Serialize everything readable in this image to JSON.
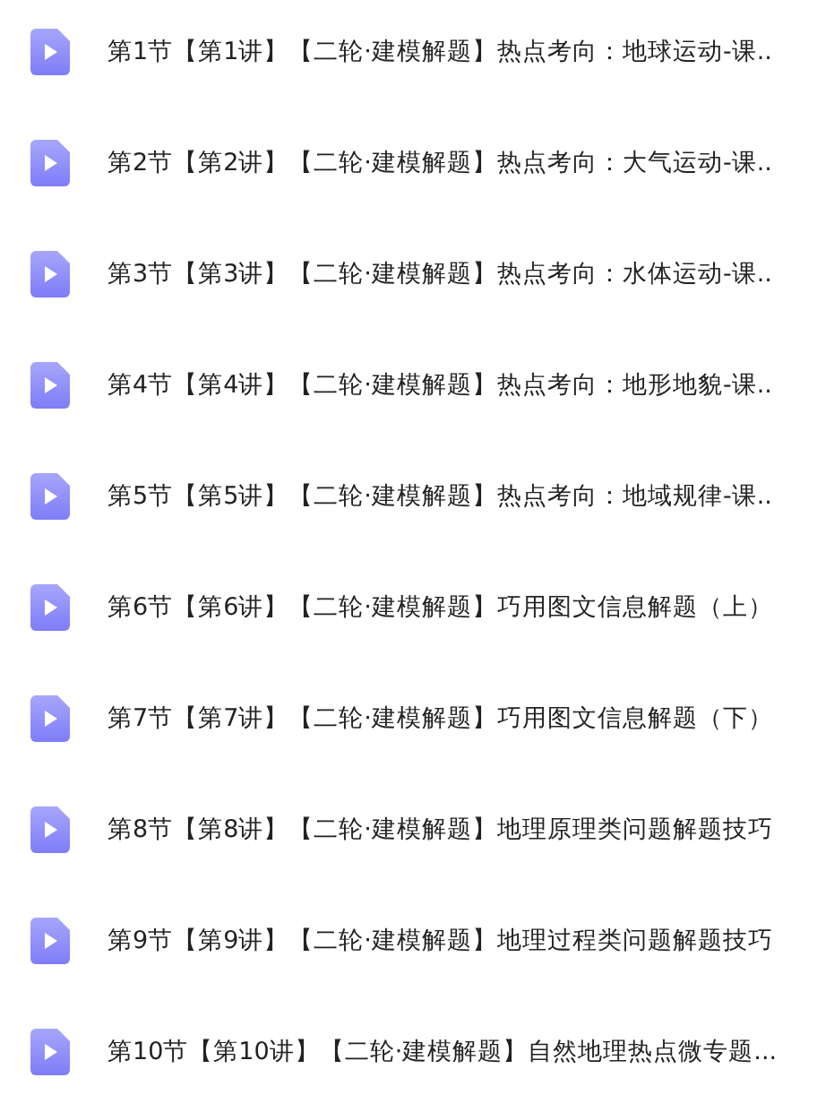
{
  "lessons": [
    {
      "title": "第1节【第1讲】【二轮·建模解题】热点考向：地球运动-课.."
    },
    {
      "title": "第2节【第2讲】【二轮·建模解题】热点考向：大气运动-课.."
    },
    {
      "title": "第3节【第3讲】【二轮·建模解题】热点考向：水体运动-课.."
    },
    {
      "title": "第4节【第4讲】【二轮·建模解题】热点考向：地形地貌-课.."
    },
    {
      "title": "第5节【第5讲】【二轮·建模解题】热点考向：地域规律-课.."
    },
    {
      "title": "第6节【第6讲】【二轮·建模解题】巧用图文信息解题（上）"
    },
    {
      "title": "第7节【第7讲】【二轮·建模解题】巧用图文信息解题（下）"
    },
    {
      "title": "第8节【第8讲】【二轮·建模解题】地理原理类问题解题技巧"
    },
    {
      "title": "第9节【第9讲】【二轮·建模解题】地理过程类问题解题技巧"
    },
    {
      "title": "第10节【第10讲】【二轮·建模解题】自然地理热点微专题..."
    }
  ]
}
